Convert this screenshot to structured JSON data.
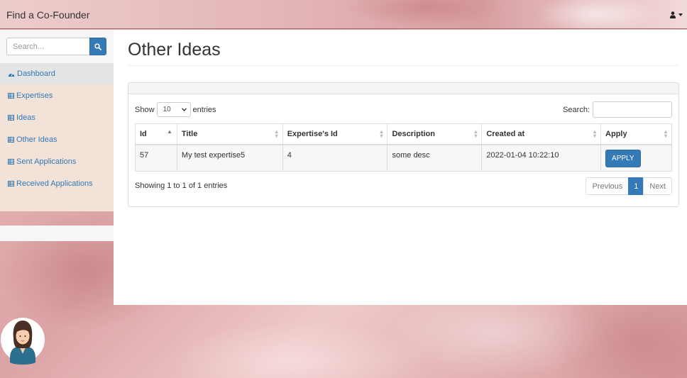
{
  "app": {
    "brand": "Find a Co-Founder"
  },
  "sidebar": {
    "search_placeholder": "Search...",
    "items": [
      {
        "label": "Dashboard",
        "icon": "dashboard-icon",
        "active": true
      },
      {
        "label": "Expertises",
        "icon": "table-icon"
      },
      {
        "label": "Ideas",
        "icon": "table-icon"
      },
      {
        "label": "Other Ideas",
        "icon": "table-icon"
      },
      {
        "label": "Sent Applications",
        "icon": "table-icon"
      },
      {
        "label": "Received Applications",
        "icon": "table-icon"
      }
    ]
  },
  "page": {
    "title": "Other Ideas"
  },
  "table_controls": {
    "show_label": "Show",
    "entries_label": "entries",
    "page_length": "10",
    "search_label": "Search:"
  },
  "table": {
    "columns": [
      "Id",
      "Title",
      "Expertise's Id",
      "Description",
      "Created at",
      "Apply"
    ],
    "rows": [
      {
        "id": "57",
        "title": "My test expertise5",
        "expertise_id": "4",
        "description": "some desc",
        "created_at": "2022-01-04 10:22:10",
        "apply_label": "APPLY"
      }
    ]
  },
  "footer": {
    "info": "Showing 1 to 1 of 1 entries",
    "previous": "Previous",
    "current_page": "1",
    "next": "Next"
  },
  "colors": {
    "primary": "#337ab7",
    "sidebar_bg": "#f2e2d8"
  }
}
